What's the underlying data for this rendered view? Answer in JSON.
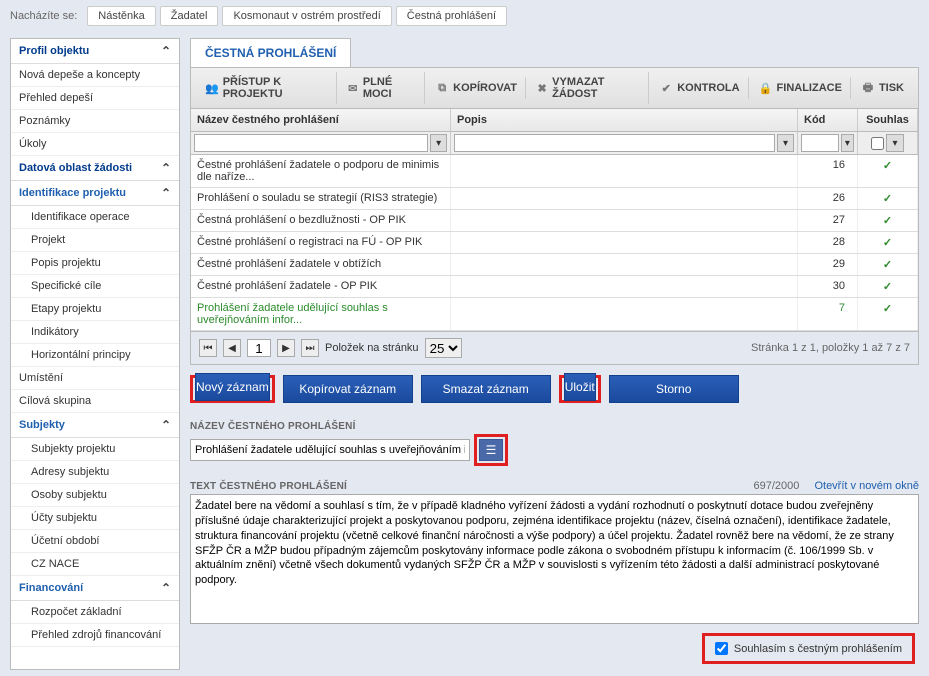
{
  "breadcrumb": {
    "label": "Nacházíte se:",
    "items": [
      "Nástěnka",
      "Žadatel",
      "Kosmonaut v ostrém prostředí",
      "Čestná prohlášení"
    ]
  },
  "sidebar": {
    "sections": [
      {
        "label": "Profil objektu",
        "items": [
          "Nová depeše a koncepty",
          "Přehled depeší",
          "Poznámky",
          "Úkoly"
        ]
      },
      {
        "label": "Datová oblast žádosti",
        "items": []
      },
      {
        "label": "Identifikace projektu",
        "items": [
          "Identifikace operace",
          "Projekt",
          "Popis projektu",
          "Specifické cíle",
          "Etapy projektu",
          "Indikátory",
          "Horizontální principy"
        ]
      },
      {
        "label_flat": "Umístění"
      },
      {
        "label_flat": "Cílová skupina"
      },
      {
        "label": "Subjekty",
        "items": [
          "Subjekty projektu",
          "Adresy subjektu",
          "Osoby subjektu",
          "Účty subjektu",
          "Účetní období",
          "CZ NACE"
        ]
      },
      {
        "label": "Financování",
        "items": [
          "Rozpočet základní",
          "Přehled zdrojů financování"
        ]
      }
    ]
  },
  "main": {
    "tab": "ČESTNÁ PROHLÁŠENÍ",
    "toolbar": {
      "access": "PŘÍSTUP K PROJEKTU",
      "powers": "PLNÉ MOCI",
      "copy": "KOPÍROVAT",
      "delete": "VYMAZAT ŽÁDOST",
      "check": "KONTROLA",
      "finalize": "FINALIZACE",
      "print": "TISK"
    },
    "grid": {
      "headers": {
        "name": "Název čestného prohlášení",
        "desc": "Popis",
        "code": "Kód",
        "consent": "Souhlas"
      },
      "rows": [
        {
          "name": "Čestné prohlášení žadatele o podporu de minimis dle naříze...",
          "desc": "",
          "code": "16",
          "consent": "✓"
        },
        {
          "name": "Prohlášení o souladu se strategií (RIS3 strategie)",
          "desc": "",
          "code": "26",
          "consent": "✓"
        },
        {
          "name": "Čestná prohlášení o bezdlužnosti - OP PIK",
          "desc": "",
          "code": "27",
          "consent": "✓"
        },
        {
          "name": "Čestné prohlášení o registraci na FÚ - OP PIK",
          "desc": "",
          "code": "28",
          "consent": "✓"
        },
        {
          "name": "Čestné prohlášení žadatele v obtížích",
          "desc": "",
          "code": "29",
          "consent": "✓"
        },
        {
          "name": "Čestné prohlášení žadatele - OP PIK",
          "desc": "",
          "code": "30",
          "consent": "✓"
        },
        {
          "name": "Prohlášení žadatele udělující souhlas s uveřejňováním infor...",
          "desc": "",
          "code": "7",
          "consent": "✓",
          "sel": true
        }
      ],
      "pager": {
        "page": "1",
        "perpage_label": "Položek na stránku",
        "perpage": "25",
        "info": "Stránka 1 z 1, položky 1 až 7 z 7"
      }
    },
    "actions": {
      "new": "Nový záznam",
      "copy": "Kopírovat záznam",
      "delete": "Smazat záznam",
      "save": "Uložit",
      "cancel": "Storno"
    },
    "form": {
      "name_label": "NÁZEV ČESTNÉHO PROHLÁŠENÍ",
      "name_value": "Prohlášení žadatele udělující souhlas s uveřejňováním informací",
      "text_label": "TEXT ČESTNÉHO PROHLÁŠENÍ",
      "counter": "697/2000",
      "open_link": "Otevřít v novém okně",
      "text_value": "Žadatel bere na vědomí a souhlasí s tím, že v případě kladného vyřízení žádosti a vydání rozhodnutí o poskytnutí dotace budou zveřejněny příslušné údaje charakterizující projekt a poskytovanou podporu, zejména identifikace projektu (název, číselná označení), identifikace žadatele, struktura financování projektu (včetně celkové finanční náročnosti a výše podpory) a účel projektu. Žadatel rovněž bere na vědomí, že ze strany SFŽP ČR a MŽP budou případným zájemcům poskytovány informace podle zákona o svobodném přístupu k informacím (č. 106/1999 Sb. v aktuálním znění) včetně všech dokumentů vydaných SFŽP ČR a MŽP v souvislosti s vyřízením této žádosti a další administrací poskytované podpory.",
      "consent_label": "Souhlasím s čestným prohlášením"
    }
  }
}
